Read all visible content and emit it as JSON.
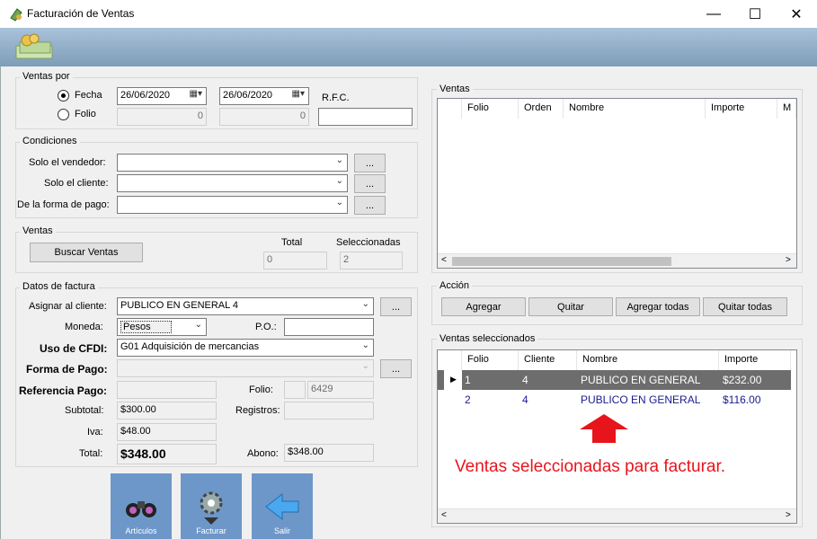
{
  "window": {
    "title": "Facturación de Ventas",
    "minimize": "—",
    "maximize": "☐",
    "close": "✕"
  },
  "ventas_por": {
    "group_title": "Ventas por",
    "fecha_label": "Fecha",
    "folio_label": "Folio",
    "fecha_desde": "26/06/2020",
    "fecha_hasta": "26/06/2020",
    "folio_desde": "0",
    "folio_hasta": "0",
    "rfc_label": "R.F.C.",
    "rfc_value": ""
  },
  "condiciones": {
    "group_title": "Condiciones",
    "vendedor_label": "Solo el  vendedor:",
    "cliente_label": "Solo el cliente:",
    "forma_pago_label": "De la forma de pago:",
    "browse": "..."
  },
  "ventas": {
    "group_title": "Ventas",
    "buscar_button": "Buscar Ventas",
    "total_label": "Total",
    "total_value": "0",
    "seleccionadas_label": "Seleccionadas",
    "seleccionadas_value": "2"
  },
  "datos_factura": {
    "group_title": "Datos de factura",
    "asignar_label": "Asignar al cliente:",
    "asignar_value": "PUBLICO EN GENERAL 4",
    "moneda_label": "Moneda:",
    "moneda_value": "Pesos",
    "po_label": "P.O.:",
    "uso_cfdi_label": "Uso de CFDI:",
    "uso_cfdi_value": "G01 Adquisición de mercancias",
    "forma_pago_label": "Forma de Pago:",
    "referencia_label": "Referencia Pago:",
    "folio_label": "Folio:",
    "folio_value": "6429",
    "subtotal_label": "Subtotal:",
    "subtotal_value": "$300.00",
    "registros_label": "Registros:",
    "iva_label": "Iva:",
    "iva_value": "$48.00",
    "total_label": "Total:",
    "total_value": "$348.00",
    "abono_label": "Abono:",
    "abono_value": "$348.00",
    "browse": "..."
  },
  "bottom_buttons": {
    "articulos": "Artículos",
    "facturar": "Facturar",
    "salir": "Salir"
  },
  "ventas_grid": {
    "group_title": "Ventas",
    "columns": [
      "Folio",
      "Orden",
      "Nombre",
      "Importe",
      "M"
    ]
  },
  "accion": {
    "group_title": "Acción",
    "agregar": "Agregar",
    "quitar": "Quitar",
    "agregar_todas": "Agregar todas",
    "quitar_todas": "Quitar todas"
  },
  "seleccionados": {
    "group_title": "Ventas seleccionados",
    "columns": [
      "Folio",
      "Cliente",
      "Nombre",
      "Importe"
    ],
    "rows": [
      [
        "1",
        "4",
        "PUBLICO EN GENERAL",
        "$232.00"
      ],
      [
        "2",
        "4",
        "PUBLICO EN GENERAL",
        "$116.00"
      ]
    ],
    "annotation": "Ventas seleccionadas para facturar."
  },
  "colors": {
    "accent_red": "#e8141c",
    "row_selected": "#6d6d6d",
    "row_text": "#1b1b8f",
    "big_button": "#6e97c9"
  }
}
